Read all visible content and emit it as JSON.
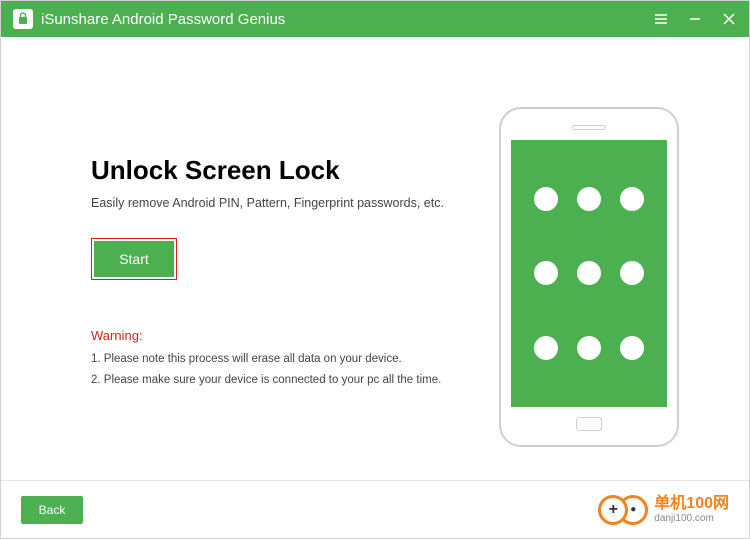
{
  "titlebar": {
    "app_title": "iSunshare Android Password Genius"
  },
  "main": {
    "heading": "Unlock Screen Lock",
    "subtext": "Easily remove Android PIN, Pattern, Fingerprint passwords, etc.",
    "start_label": "Start",
    "warning_title": "Warning:",
    "warning_1": "1. Please note this process will erase all data on your device.",
    "warning_2": "2. Please make sure your device is connected to your pc all the time."
  },
  "footer": {
    "back_label": "Back"
  },
  "watermark": {
    "plus": "+",
    "dot": "●",
    "cn": "单机100网",
    "en": "danji100.com"
  }
}
